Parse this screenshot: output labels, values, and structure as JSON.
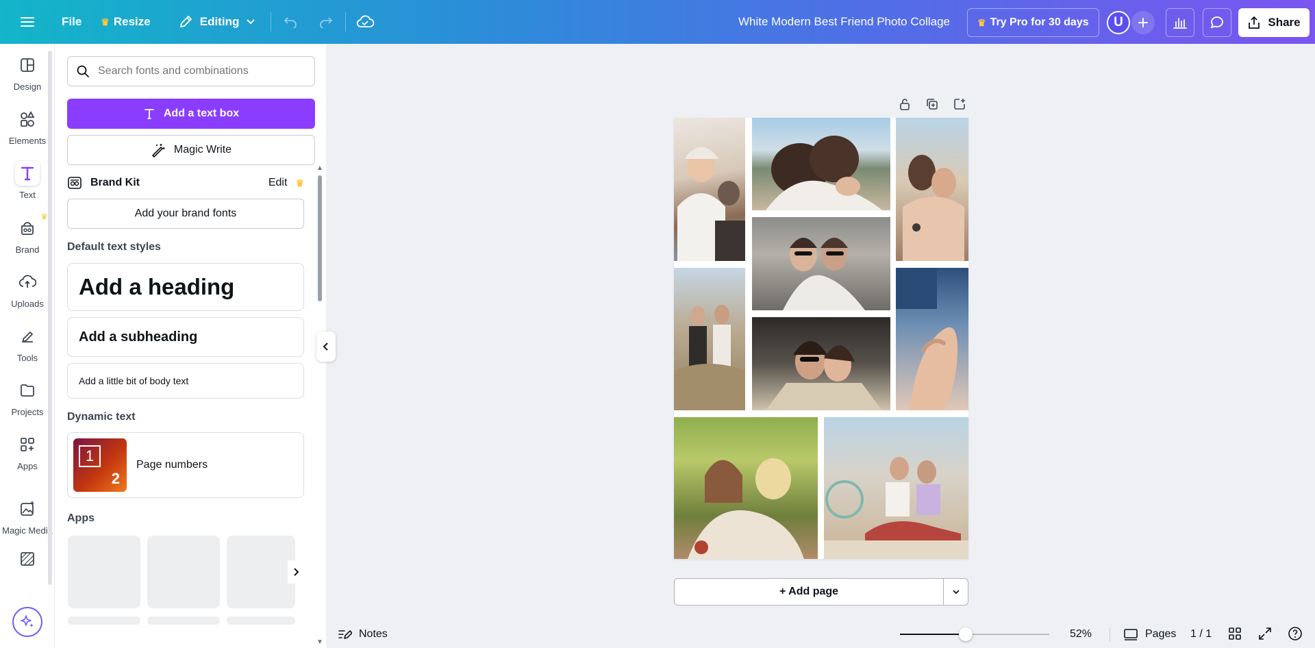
{
  "topbar": {
    "file": "File",
    "resize": "Resize",
    "mode": "Editing",
    "title": "White Modern Best Friend Photo Collage",
    "try_pro": "Try Pro for 30 days",
    "avatar_initial": "U",
    "share": "Share"
  },
  "rail": {
    "items": [
      {
        "label": "Design",
        "icon": "design-icon"
      },
      {
        "label": "Elements",
        "icon": "elements-icon"
      },
      {
        "label": "Text",
        "icon": "text-icon",
        "active": true
      },
      {
        "label": "Brand",
        "icon": "brand-icon"
      },
      {
        "label": "Uploads",
        "icon": "uploads-icon"
      },
      {
        "label": "Tools",
        "icon": "tools-icon"
      },
      {
        "label": "Projects",
        "icon": "projects-icon"
      },
      {
        "label": "Apps",
        "icon": "apps-icon"
      },
      {
        "label": "Magic Media",
        "icon": "magic-media-icon"
      },
      {
        "label": "",
        "icon": "background-icon"
      }
    ]
  },
  "panel": {
    "search_placeholder": "Search fonts and combinations",
    "add_text_box": "Add a text box",
    "magic_write": "Magic Write",
    "brand_kit": "Brand Kit",
    "brand_kit_edit": "Edit",
    "add_brand_fonts": "Add your brand fonts",
    "default_styles_title": "Default text styles",
    "heading": "Add a heading",
    "subheading": "Add a subheading",
    "body": "Add a little bit of body text",
    "dynamic_title": "Dynamic text",
    "page_numbers": "Page numbers",
    "page_numbers_thumb": {
      "first": "1",
      "second": "2"
    },
    "apps_title": "Apps"
  },
  "canvas": {
    "add_page": "+ Add page"
  },
  "bottombar": {
    "notes": "Notes",
    "zoom": "52%",
    "zoom_level": 0.52,
    "pages": "Pages",
    "page_count": "1 / 1"
  },
  "colors": {
    "accent_purple": "#8b3dff",
    "topbar_start": "#13b5c9",
    "topbar_end": "#7a55f0",
    "crown": "#ffc83d"
  }
}
